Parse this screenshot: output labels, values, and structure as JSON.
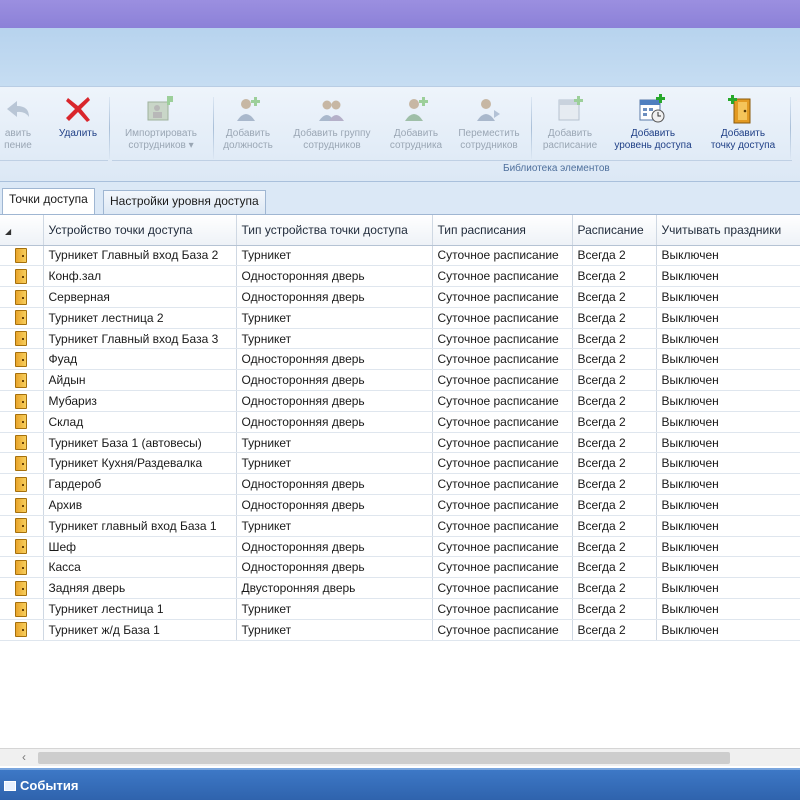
{
  "ribbon": {
    "buttons": [
      {
        "label": "авить\nпение",
        "enabled": false,
        "icon": "undo-arrow-icon"
      },
      {
        "label": "Удалить",
        "enabled": true,
        "icon": "delete-x-icon"
      },
      {
        "label": "Импортировать\nсотрудников ▾",
        "enabled": false,
        "icon": "import-employees-icon"
      },
      {
        "label": "Добавить\nдолжность",
        "enabled": false,
        "icon": "add-position-icon"
      },
      {
        "label": "Добавить группу\nсотрудников",
        "enabled": false,
        "icon": "add-group-icon"
      },
      {
        "label": "Добавить\nсотрудника",
        "enabled": false,
        "icon": "add-employee-icon"
      },
      {
        "label": "Переместить\nсотрудников",
        "enabled": false,
        "icon": "move-employees-icon"
      },
      {
        "label": "Добавить\nрасписание",
        "enabled": false,
        "icon": "add-schedule-icon"
      },
      {
        "label": "Добавить\nуровень доступа",
        "enabled": true,
        "icon": "add-access-level-icon"
      },
      {
        "label": "Добавить\nточку доступа",
        "enabled": true,
        "icon": "add-access-point-icon"
      }
    ],
    "group_label": "Библиотека элементов"
  },
  "tabs": [
    {
      "label": "Точки доступа",
      "active": true
    },
    {
      "label": "Настройки уровня доступа",
      "active": false
    }
  ],
  "grid": {
    "columns": [
      "Устройство точки доступа",
      "Тип устройства точки доступа",
      "Тип расписания",
      "Расписание",
      "Учитывать праздники"
    ],
    "rows": [
      [
        "Турникет Главный вход База 2",
        "Турникет",
        "Суточное расписание",
        "Всегда 2",
        "Выключен"
      ],
      [
        "Конф.зал",
        "Односторонняя дверь",
        "Суточное расписание",
        "Всегда 2",
        "Выключен"
      ],
      [
        "Серверная",
        "Односторонняя дверь",
        "Суточное расписание",
        "Всегда 2",
        "Выключен"
      ],
      [
        "Турникет лестница 2",
        "Турникет",
        "Суточное расписание",
        "Всегда 2",
        "Выключен"
      ],
      [
        "Турникет Главный вход База 3",
        "Турникет",
        "Суточное расписание",
        "Всегда 2",
        "Выключен"
      ],
      [
        "Фуад",
        "Односторонняя дверь",
        "Суточное расписание",
        "Всегда 2",
        "Выключен"
      ],
      [
        "Айдын",
        "Односторонняя дверь",
        "Суточное расписание",
        "Всегда 2",
        "Выключен"
      ],
      [
        "Мубариз",
        "Односторонняя дверь",
        "Суточное расписание",
        "Всегда 2",
        "Выключен"
      ],
      [
        "Склад",
        "Односторонняя дверь",
        "Суточное расписание",
        "Всегда 2",
        "Выключен"
      ],
      [
        "Турникет База 1 (автовесы)",
        "Турникет",
        "Суточное расписание",
        "Всегда 2",
        "Выключен"
      ],
      [
        "Турникет Кухня/Раздевалка",
        "Турникет",
        "Суточное расписание",
        "Всегда 2",
        "Выключен"
      ],
      [
        "Гардероб",
        "Односторонняя дверь",
        "Суточное расписание",
        "Всегда 2",
        "Выключен"
      ],
      [
        "Архив",
        "Односторонняя дверь",
        "Суточное расписание",
        "Всегда 2",
        "Выключен"
      ],
      [
        "Турникет главный вход База 1",
        "Турникет",
        "Суточное расписание",
        "Всегда 2",
        "Выключен"
      ],
      [
        "Шеф",
        "Односторонняя дверь",
        "Суточное расписание",
        "Всегда 2",
        "Выключен"
      ],
      [
        "Касса",
        "Односторонняя дверь",
        "Суточное расписание",
        "Всегда 2",
        "Выключен"
      ],
      [
        "Задняя дверь",
        "Двусторонняя дверь",
        "Суточное расписание",
        "Всегда 2",
        "Выключен"
      ],
      [
        "Турникет лестница 1",
        "Турникет",
        "Суточное расписание",
        "Всегда 2",
        "Выключен"
      ],
      [
        "Турникет ж/д База 1",
        "Турникет",
        "Суточное расписание",
        "Всегда 2",
        "Выключен"
      ]
    ]
  },
  "scrollbar": {
    "left_arrow": "‹"
  },
  "bottom_bar": {
    "label": "События"
  },
  "colors": {
    "title_bar": "#8c81d8",
    "ribbon_bg": "#dce8f5",
    "bottom_bar": "#2f63ad",
    "delete_red": "#d9262c",
    "door_orange": "#e9a52b"
  }
}
